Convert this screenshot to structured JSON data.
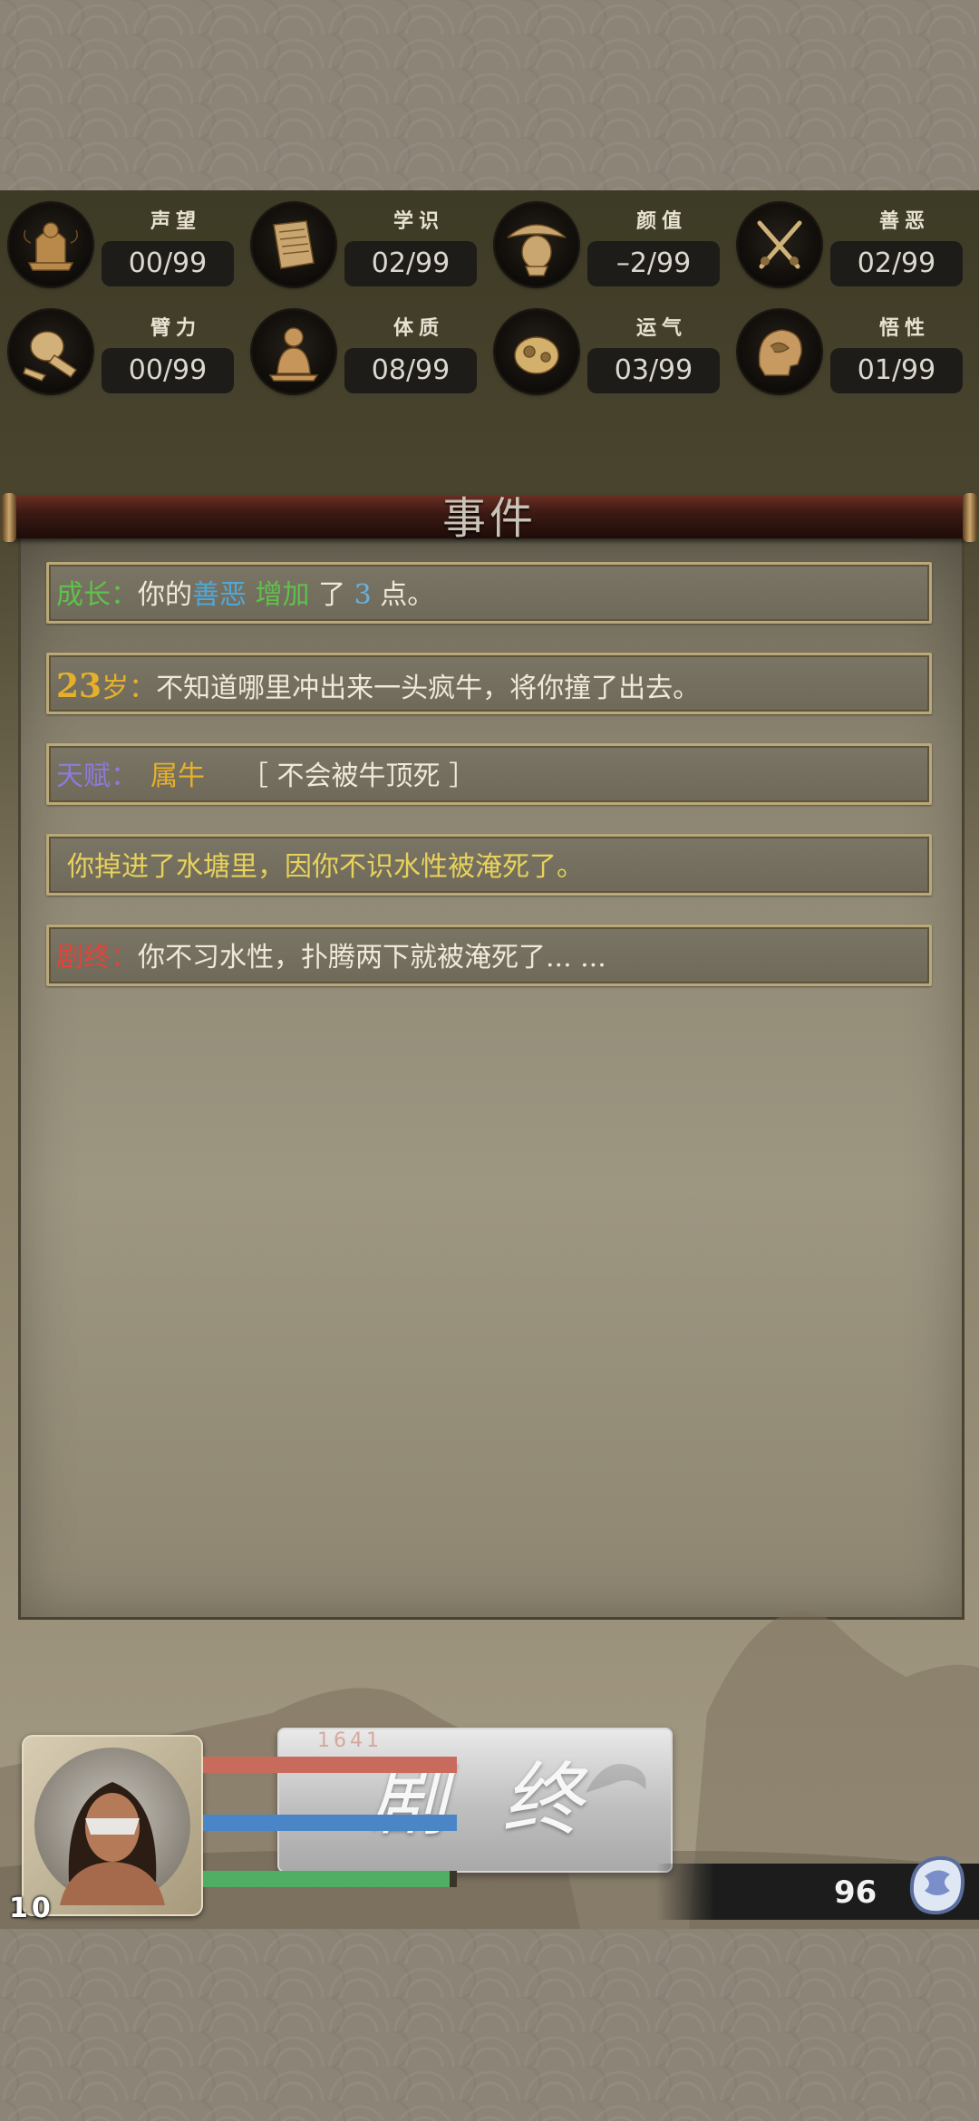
{
  "stats": [
    {
      "label": "声望",
      "value": "00/99",
      "icon": "reputation-icon"
    },
    {
      "label": "学识",
      "value": "02/99",
      "icon": "knowledge-scroll-icon"
    },
    {
      "label": "颜值",
      "value": "–2/99",
      "icon": "hat-face-icon"
    },
    {
      "label": "善恶",
      "value": "02/99",
      "icon": "crossed-swords-icon"
    },
    {
      "label": "臂力",
      "value": "00/99",
      "icon": "fist-icon"
    },
    {
      "label": "体质",
      "value": "08/99",
      "icon": "buddha-icon"
    },
    {
      "label": "运气",
      "value": "03/99",
      "icon": "coin-pouch-icon"
    },
    {
      "label": "悟性",
      "value": "01/99",
      "icon": "mind-head-icon"
    }
  ],
  "panel": {
    "title": "事件"
  },
  "events": [
    {
      "tag": "成长：",
      "p1": "你的",
      "attr": "善恶",
      "sp": " ",
      "verb": "增加",
      "p2": " 了 ",
      "num": "3",
      "p3": " 点。"
    },
    {
      "age": "23",
      "age_unit": "岁：",
      "text": "不知道哪里冲出来一头疯牛，将你撞了出去。"
    },
    {
      "tag": "天赋：",
      "talent": "属牛",
      "desc": "［ 不会被牛顶死 ］"
    },
    {
      "text": "你掉进了水塘里，因你不识水性被淹死了。"
    },
    {
      "tag": "剧终：",
      "text": "你不习水性，扑腾两下就被淹死了... ..."
    }
  ],
  "end_button": {
    "label": "剧终"
  },
  "player": {
    "level": "10",
    "hp_value": "1641",
    "bars": [
      {
        "name": "health",
        "color": "#c96b5c",
        "fill": 1.0
      },
      {
        "name": "mana",
        "color": "#4a86c7",
        "fill": 1.0
      },
      {
        "name": "stamina",
        "color": "#4fae63",
        "fill": 0.97
      }
    ]
  },
  "currency": {
    "value": "96",
    "icon": "silver-ingot-icon"
  }
}
